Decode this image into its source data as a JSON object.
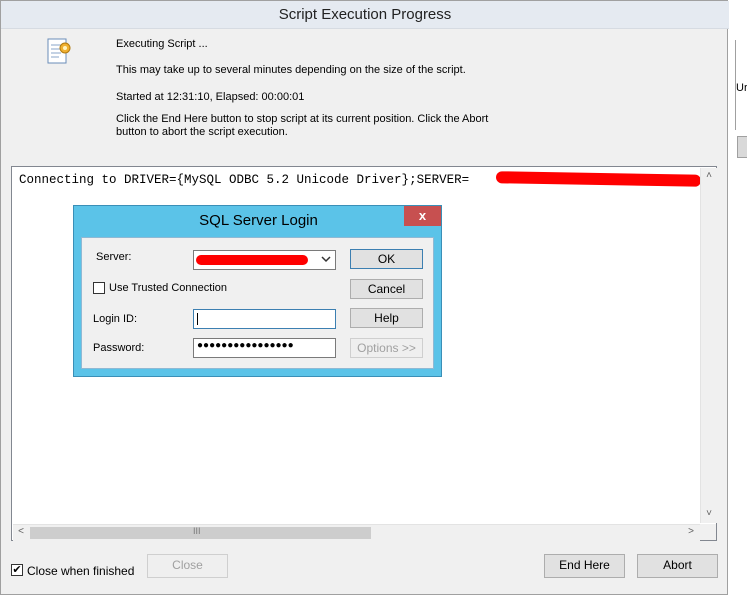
{
  "window": {
    "title": "Script Execution Progress"
  },
  "info": {
    "executing": "Executing Script ...",
    "duration_note": "This may take up to several minutes depending on the size of the script.",
    "timing": "Started at 12:31:10, Elapsed: 00:00:01",
    "help_line1": "Click the End Here button to stop script at its current position. Click the Abort",
    "help_line2": "button to abort the script execution."
  },
  "output": {
    "text": "Connecting to DRIVER={MySQL ODBC 5.2 Unicode Driver};SERVER=",
    "scroll_up": "˄",
    "scroll_down": "˅",
    "scroll_left": "<",
    "scroll_right": ">",
    "thumb_grip": "III"
  },
  "login_dialog": {
    "title": "SQL Server Login",
    "close": "x",
    "server_label": "Server:",
    "trusted_label": "Use Trusted Connection",
    "login_id_label": "Login ID:",
    "password_label": "Password:",
    "password_value": "●●●●●●●●●●●●●●●●",
    "ok": "OK",
    "cancel": "Cancel",
    "help": "Help",
    "options": "Options >>"
  },
  "footer": {
    "close_when_finished_label": "Close when finished",
    "close_when_finished_checked": "✔",
    "close": "Close",
    "end_here": "End Here",
    "abort": "Abort"
  },
  "background_text": "Ur",
  "icons": {
    "app": "script-edit-icon",
    "dropdown": "chevron-down-icon"
  }
}
